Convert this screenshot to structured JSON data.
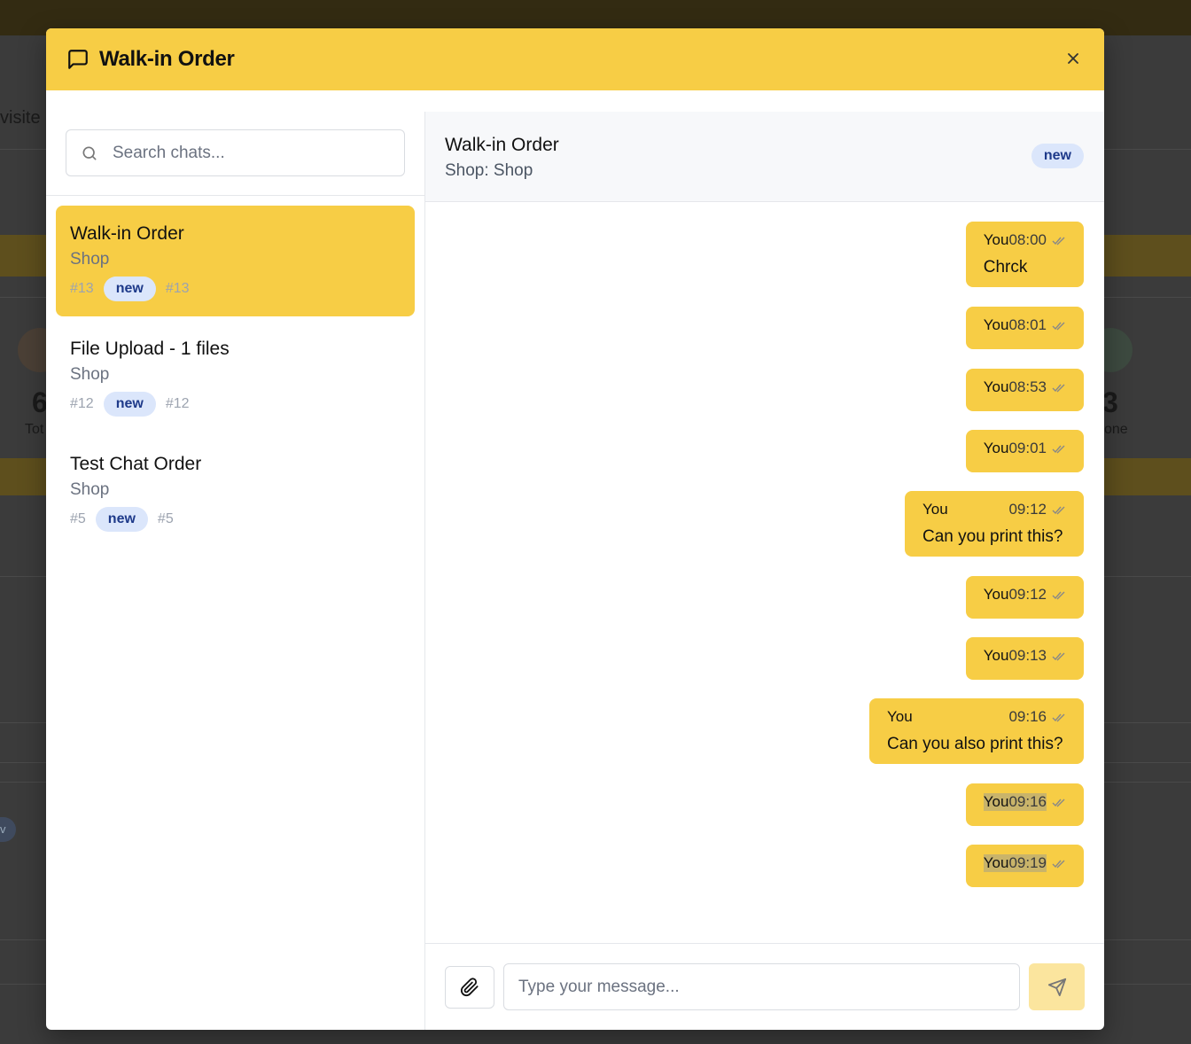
{
  "background": {
    "visible_text": [
      "visite",
      "6",
      "Tot",
      "3",
      "one",
      "v"
    ]
  },
  "modal": {
    "title": "Walk-in Order",
    "icons": {
      "header": "message-square-icon",
      "close": "close-icon"
    }
  },
  "sidebar": {
    "search_placeholder": "Search chats...",
    "chats": [
      {
        "title": "Walk-in Order",
        "shop": "Shop",
        "id_left": "#13",
        "status": "new",
        "id_right": "#13",
        "active": true
      },
      {
        "title": "File Upload - 1 files",
        "shop": "Shop",
        "id_left": "#12",
        "status": "new",
        "id_right": "#12",
        "active": false
      },
      {
        "title": "Test Chat Order",
        "shop": "Shop",
        "id_left": "#5",
        "status": "new",
        "id_right": "#5",
        "active": false
      }
    ]
  },
  "conversation": {
    "title": "Walk-in Order",
    "subtitle": "Shop: Shop",
    "status_badge": "new",
    "messages": [
      {
        "sender": "You",
        "time": "08:00",
        "text": "Chrck"
      },
      {
        "sender": "You",
        "time": "08:01",
        "text": ""
      },
      {
        "sender": "You",
        "time": "08:53",
        "text": ""
      },
      {
        "sender": "You",
        "time": "09:01",
        "text": ""
      },
      {
        "sender": "You",
        "time": "09:12",
        "text": "Can you print this?"
      },
      {
        "sender": "You",
        "time": "09:12",
        "text": ""
      },
      {
        "sender": "You",
        "time": "09:13",
        "text": ""
      },
      {
        "sender": "You",
        "time": "09:16",
        "text": "Can you also print this?"
      },
      {
        "sender": "You",
        "time": "09:16",
        "text": ""
      },
      {
        "sender": "You",
        "time": "09:19",
        "text": ""
      }
    ]
  },
  "composer": {
    "placeholder": "Type your message...",
    "icons": {
      "attach": "paperclip-icon",
      "send": "send-icon"
    }
  },
  "colors": {
    "accent": "#f7cd45",
    "badge_bg": "#dbe6fb",
    "badge_text": "#1e3a8a",
    "send_disabled": "#fbe59e"
  }
}
